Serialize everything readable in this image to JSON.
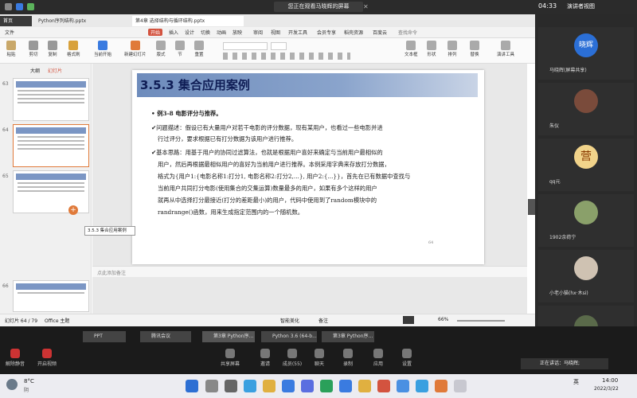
{
  "top": {
    "sharing": "您正在观看马晓辉的屏幕",
    "time": "04:33",
    "view": "演讲者视图"
  },
  "tabs": {
    "t1": "Python序列结构.pptx",
    "t2": "第4章 选择结构与循环结构.pptx"
  },
  "menu": [
    "文件",
    "开始",
    "插入",
    "设计",
    "切换",
    "动画",
    "放映",
    "审阅",
    "视图",
    "开发工具",
    "会员专享",
    "稻壳资源",
    "百度云",
    "查找命令"
  ],
  "ribbon": [
    "粘贴",
    "剪切",
    "复制",
    "格式刷",
    "当前开始",
    "新建幻灯片",
    "版式",
    "节",
    "重置",
    "文本框",
    "形状",
    "排列",
    "替换",
    "演讲工具"
  ],
  "panel": {
    "outline": "大纲",
    "slides": "幻灯片",
    "nums": [
      "63",
      "64",
      "65",
      "66"
    ],
    "tip": "3.5.3 集合应用案例",
    "note": "点此添加备注"
  },
  "slide": {
    "title": "3.5.3  集合应用案例",
    "lines": [
      "• 例3-8  电影评分与推荐。",
      "✔问题描述：假设已有大量用户对若干电影的评分数据，现有某用户，也看过一些电影并进",
      "行过评分，要求根据已有打分数据为该用户进行推荐。",
      "✔基本思路：用基于用户的协同过滤算法，也就是根据用户喜好来确定与当前用户最相似的",
      "用户，然后再根据最相似用户的喜好为当前用户进行推荐。本例采用字典来存放打分数据，",
      "格式为{用户1:{电影名称1:打分1, 电影名称2:打分2,...}, 用户2:{...}}，首先在已有数据中查找与",
      "当前用户共同打分电影(使用集合的交集运算)数量最多的用户，如果有多个这样的用户",
      "就再从中选择打分最接近(打分的差距最小)的用户，代码中使用到了random模块中的",
      "randrange()函数，用来生成指定范围内的一个随机数。"
    ],
    "page": "64"
  },
  "status": {
    "slide": "幻灯片 64 / 79",
    "theme": "Office 主题",
    "smart": "智能美化",
    "notes": "备注",
    "zoom": "66%"
  },
  "participants": [
    {
      "name": "晓辉",
      "label": "马晓辉(屏幕共享)"
    },
    {
      "name": "",
      "label": "朱仪"
    },
    {
      "name": "营",
      "label": "qq元"
    },
    {
      "name": "",
      "label": "1902余荷宁"
    },
    {
      "name": "",
      "label": "小老小猫(hx·木si)"
    },
    {
      "name": "",
      "label": ""
    }
  ],
  "meeting": {
    "mute": "解除静音",
    "video": "开启视频",
    "share": "共享屏幕",
    "invite": "邀请",
    "members": "成员(55)",
    "chat": "聊天",
    "record": "录制",
    "apps": "应用",
    "settings": "设置",
    "speaking": "正在讲话：马晓辉;"
  },
  "taskbar_apps": [
    "PPT",
    "腾讯会议",
    "第3章 Python序...",
    "Python 3.6 (64-b...",
    "第3章 Python序..."
  ],
  "weather": {
    "temp": "8°C",
    "desc": "阴"
  },
  "clock": {
    "time": "14:00",
    "date": "2022/3/22",
    "lang": "英"
  },
  "colors": {
    "accent": "#d3533f",
    "wps_blue": "#2b7cd3",
    "slide_title": "#6e8cbc"
  }
}
